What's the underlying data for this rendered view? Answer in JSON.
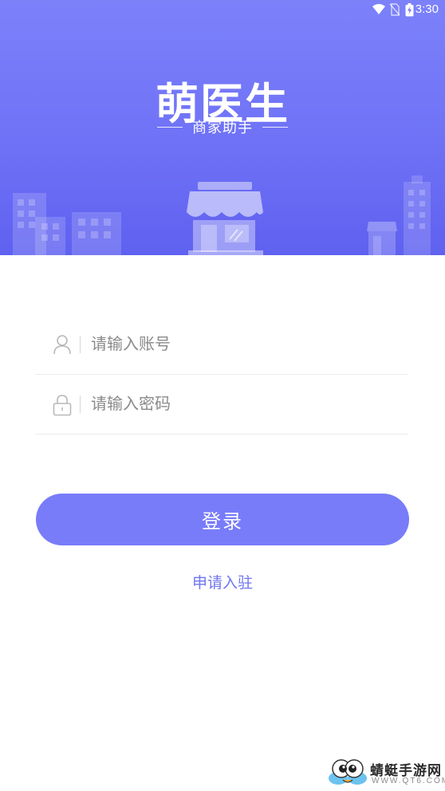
{
  "status_bar": {
    "time": "3:30",
    "icons": [
      "wifi-icon",
      "no-sim-icon",
      "battery-charging-icon"
    ]
  },
  "header": {
    "logo_title": "萌医生",
    "logo_subtitle": "商家助手"
  },
  "form": {
    "account_placeholder": "请输入账号",
    "account_icon": "user-icon",
    "password_placeholder": "请输入密码",
    "password_icon": "lock-icon"
  },
  "login_button": "登录",
  "apply_link": "申请入驻",
  "watermark": {
    "title": "蜻蜓手游网",
    "url": "WWW.QT6.COM"
  },
  "colors": {
    "header_top": "#7c81fa",
    "header_bottom": "#5f61f0",
    "button": "#787cf9",
    "link": "#7075ef"
  }
}
